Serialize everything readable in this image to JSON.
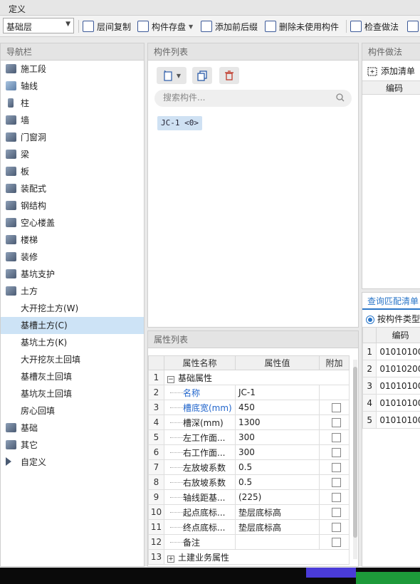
{
  "window": {
    "title": "定义"
  },
  "toolbar": {
    "floor_value": "基础层",
    "buttons": [
      {
        "label": "层间复制",
        "icon": "copy-layer-icon"
      },
      {
        "label": "构件存盘",
        "icon": "save-component-icon"
      },
      {
        "label": "添加前后缀",
        "icon": "add-prefix-icon"
      },
      {
        "label": "删除未使用构件",
        "icon": "delete-unused-icon"
      },
      {
        "label": "检查做法",
        "icon": "check-method-icon"
      }
    ]
  },
  "nav": {
    "header": "导航栏",
    "items_top": [
      "施工段",
      "轴线",
      "柱",
      "墙",
      "门窗洞",
      "梁",
      "板",
      "装配式",
      "钢结构",
      "空心楼盖",
      "楼梯",
      "装修",
      "基坑支护",
      "土方"
    ],
    "sub_items": [
      "大开挖土方(W)",
      "基槽土方(C)",
      "基坑土方(K)",
      "大开挖灰土回填",
      "基槽灰土回填",
      "基坑灰土回填",
      "房心回填"
    ],
    "active_sub": "基槽土方(C)",
    "items_bottom": [
      "基础",
      "其它",
      "自定义"
    ]
  },
  "comp_list": {
    "header": "构件列表",
    "search_placeholder": "搜索构件...",
    "item": "JC-1 <0>"
  },
  "props": {
    "header": "属性列表",
    "columns": [
      "属性名称",
      "属性值",
      "附加"
    ],
    "rows": [
      {
        "n": "1",
        "name": "基础属性",
        "value": "",
        "group": "minus"
      },
      {
        "n": "2",
        "name": "名称",
        "value": "JC-1",
        "blue": true
      },
      {
        "n": "3",
        "name": "槽底宽(mm)",
        "value": "450",
        "blue": true,
        "cb": true
      },
      {
        "n": "4",
        "name": "槽深(mm)",
        "value": "1300",
        "cb": true
      },
      {
        "n": "5",
        "name": "左工作面...",
        "value": "300",
        "cb": true
      },
      {
        "n": "6",
        "name": "右工作面...",
        "value": "300",
        "cb": true
      },
      {
        "n": "7",
        "name": "左放坡系数",
        "value": "0.5",
        "cb": true
      },
      {
        "n": "8",
        "name": "右放坡系数",
        "value": "0.5",
        "cb": true
      },
      {
        "n": "9",
        "name": "轴线距基...",
        "value": "(225)",
        "cb": true
      },
      {
        "n": "10",
        "name": "起点底标...",
        "value": "垫层底标高",
        "cb": true
      },
      {
        "n": "11",
        "name": "终点底标...",
        "value": "垫层底标高",
        "cb": true
      },
      {
        "n": "12",
        "name": "备注",
        "value": "",
        "cb": true
      },
      {
        "n": "13",
        "name": "土建业务属性",
        "value": "",
        "group": "plus"
      }
    ]
  },
  "method": {
    "header": "构件做法",
    "add_label": "添加清单",
    "col": "编码"
  },
  "match": {
    "tab": "查询匹配清单",
    "radio": "按构件类型",
    "col": "编码",
    "rows": [
      {
        "n": "1",
        "code": "01010100"
      },
      {
        "n": "2",
        "code": "01010200"
      },
      {
        "n": "3",
        "code": "01010100"
      },
      {
        "n": "4",
        "code": "01010100"
      },
      {
        "n": "5",
        "code": "01010100"
      }
    ]
  }
}
